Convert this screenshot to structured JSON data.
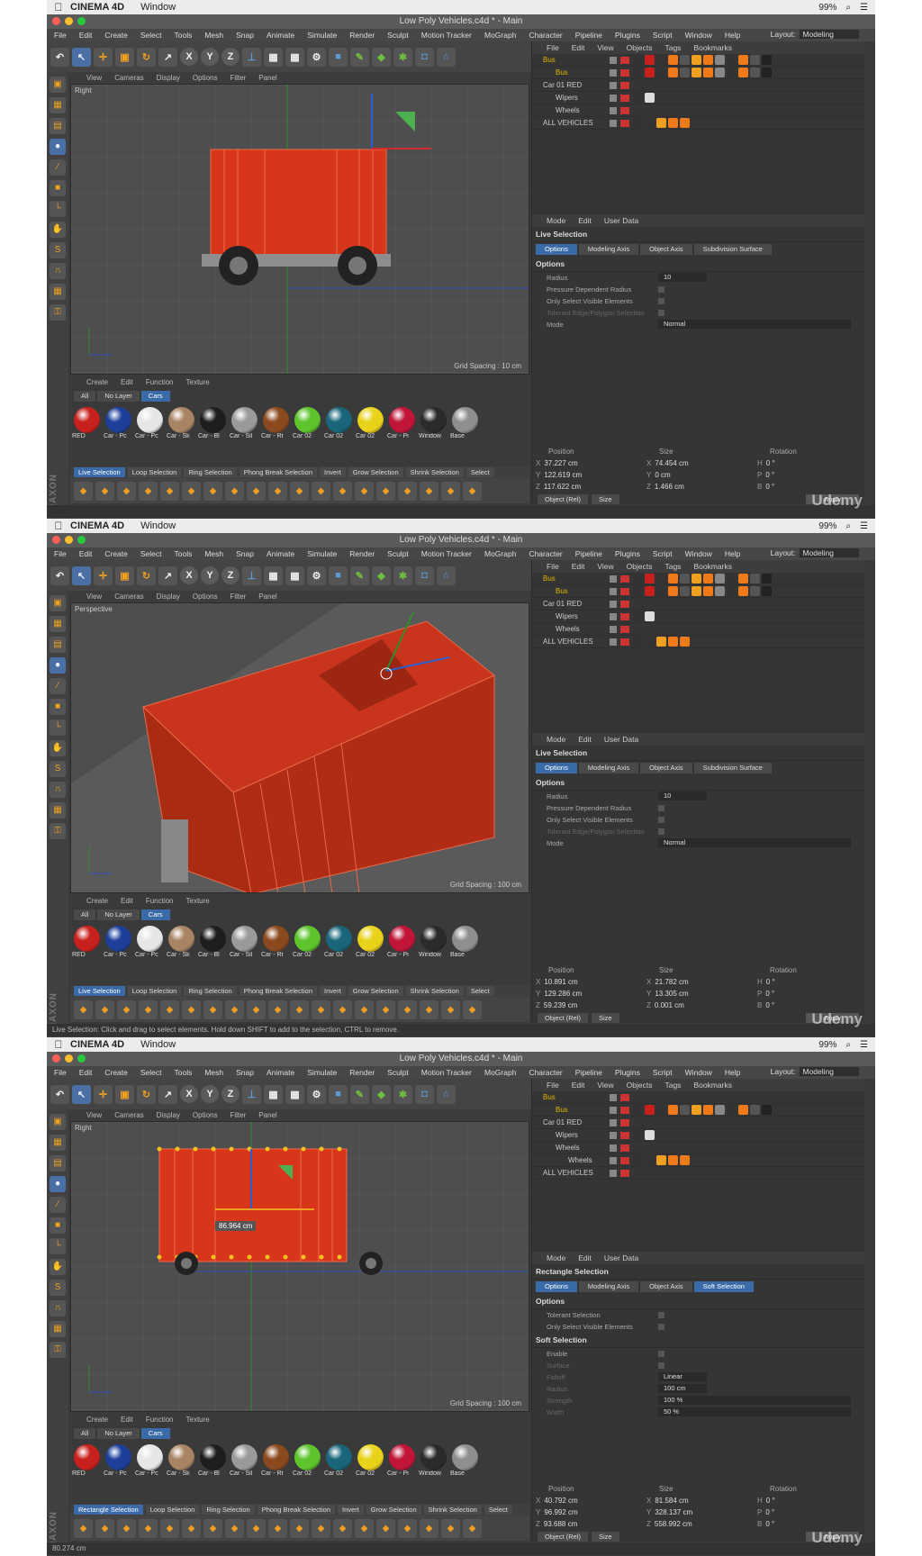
{
  "menubar": {
    "app": "CINEMA 4D",
    "window": "Window",
    "battery": "99%"
  },
  "title": "Low Poly Vehicles.c4d * - Main",
  "menus": [
    "File",
    "Edit",
    "Create",
    "Select",
    "Tools",
    "Mesh",
    "Snap",
    "Animate",
    "Simulate",
    "Render",
    "Sculpt",
    "Motion Tracker",
    "MoGraph",
    "Character",
    "Pipeline",
    "Plugins",
    "Script",
    "Window",
    "Help"
  ],
  "layout_label": "Layout:",
  "layout_value": "Modeling",
  "vp_menu": [
    "View",
    "Cameras",
    "Display",
    "Options",
    "Filter",
    "Panel"
  ],
  "obj_menu": [
    "File",
    "Edit",
    "View",
    "Objects",
    "Tags",
    "Bookmarks"
  ],
  "attr_menu": [
    "Mode",
    "Edit",
    "User Data"
  ],
  "mat_menu": [
    "Create",
    "Edit",
    "Function",
    "Texture"
  ],
  "mat_tabs": [
    "All",
    "No Layer",
    "Cars"
  ],
  "materials": [
    {
      "label": "RED",
      "color": "#c8201c"
    },
    {
      "label": "Car - Pc",
      "color": "#1d3f9a"
    },
    {
      "label": "Car - Pc",
      "color": "#e6e6e6"
    },
    {
      "label": "Car - Sk",
      "color": "#a88462"
    },
    {
      "label": "Car - Bl",
      "color": "#1e1e1e"
    },
    {
      "label": "Car - Sil",
      "color": "#9a9a9a"
    },
    {
      "label": "Car - Rt",
      "color": "#8a4a1e"
    },
    {
      "label": "Car 02",
      "color": "#5dc42b"
    },
    {
      "label": "Car 02",
      "color": "#19657a"
    },
    {
      "label": "Car 02",
      "color": "#e8d21a"
    },
    {
      "label": "Car - Pi",
      "color": "#c01538"
    },
    {
      "label": "Window",
      "color": "#2b2b2b"
    },
    {
      "label": "Base",
      "color": "#8e8e8e"
    }
  ],
  "sel_tools": [
    "Live Selection",
    "Loop Selection",
    "Ring Selection",
    "Phong Break Selection",
    "Invert",
    "Grow Selection",
    "Shrink Selection",
    "Select"
  ],
  "coords_head": [
    "Position",
    "Size",
    "Rotation"
  ],
  "coords_foot": {
    "mode": "Object (Rel)",
    "size": "Size",
    "apply": "Apply"
  },
  "watermark": "Udemy",
  "frames": [
    {
      "viewport_label": "Right",
      "grid": "Grid Spacing : 10 cm",
      "objects": [
        {
          "name": "Bus",
          "color": "#e5b400",
          "indent": 0
        },
        {
          "name": "Bus",
          "color": "#e5b400",
          "indent": 1
        },
        {
          "name": "Car 01 RED",
          "color": "#cccccc",
          "indent": 0
        },
        {
          "name": "Wipers",
          "color": "#cccccc",
          "indent": 1
        },
        {
          "name": "Wheels",
          "color": "#cccccc",
          "indent": 1
        },
        {
          "name": "ALL VEHICLES",
          "color": "#cccccc",
          "indent": 0
        }
      ],
      "tool_title": "Live Selection",
      "attr_tabs": [
        "Options",
        "Modeling Axis",
        "Object Axis",
        "Subdivision Surface"
      ],
      "section": "Options",
      "attrs": [
        {
          "label": "Radius",
          "value": "10",
          "kind": "num"
        },
        {
          "label": "Pressure Dependent Radius",
          "kind": "chk"
        },
        {
          "label": "Only Select Visible Elements",
          "kind": "chk"
        },
        {
          "label": "Tolerant Edge/Polygon Selection",
          "kind": "chk",
          "dim": true
        },
        {
          "label": "Mode",
          "value": "Normal",
          "kind": "wide"
        }
      ],
      "coords": [
        [
          "X",
          "37.227 cm",
          "X",
          "74.454 cm",
          "H",
          "0 °"
        ],
        [
          "Y",
          "122.619 cm",
          "Y",
          "0 cm",
          "P",
          "0 °"
        ],
        [
          "Z",
          "117.622 cm",
          "Z",
          "1.466 cm",
          "B",
          "0 °"
        ]
      ],
      "status": ""
    },
    {
      "viewport_label": "Perspective",
      "grid": "Grid Spacing : 100 cm",
      "objects": [
        {
          "name": "Bus",
          "color": "#e5b400",
          "indent": 0
        },
        {
          "name": "Bus",
          "color": "#e5b400",
          "indent": 1
        },
        {
          "name": "Car 01 RED",
          "color": "#cccccc",
          "indent": 0
        },
        {
          "name": "Wipers",
          "color": "#cccccc",
          "indent": 1
        },
        {
          "name": "Wheels",
          "color": "#cccccc",
          "indent": 1
        },
        {
          "name": "ALL VEHICLES",
          "color": "#cccccc",
          "indent": 0
        }
      ],
      "tool_title": "Live Selection",
      "attr_tabs": [
        "Options",
        "Modeling Axis",
        "Object Axis",
        "Subdivision Surface"
      ],
      "section": "Options",
      "attrs": [
        {
          "label": "Radius",
          "value": "10",
          "kind": "num"
        },
        {
          "label": "Pressure Dependent Radius",
          "kind": "chk"
        },
        {
          "label": "Only Select Visible Elements",
          "kind": "chk"
        },
        {
          "label": "Tolerant Edge/Polygon Selection",
          "kind": "chk",
          "dim": true
        },
        {
          "label": "Mode",
          "value": "Normal",
          "kind": "wide"
        }
      ],
      "coords": [
        [
          "X",
          "10.891 cm",
          "X",
          "21.782 cm",
          "H",
          "0 °"
        ],
        [
          "Y",
          "129.286 cm",
          "Y",
          "13.305 cm",
          "P",
          "0 °"
        ],
        [
          "Z",
          "59.239 cm",
          "Z",
          "0.001 cm",
          "B",
          "0 °"
        ]
      ],
      "status": "Live Selection: Click and drag to select elements. Hold down SHIFT to add to the selection, CTRL to remove."
    },
    {
      "viewport_label": "Right",
      "grid": "Grid Spacing : 100 cm",
      "dimension": "86.964 cm",
      "objects": [
        {
          "name": "Bus",
          "color": "#e5b400",
          "indent": 0
        },
        {
          "name": "Bus",
          "color": "#e5b400",
          "indent": 1
        },
        {
          "name": "Car 01 RED",
          "color": "#cccccc",
          "indent": 0
        },
        {
          "name": "Wipers",
          "color": "#cccccc",
          "indent": 1
        },
        {
          "name": "Wheels",
          "color": "#cccccc",
          "indent": 1
        },
        {
          "name": "Wheels",
          "color": "#cccccc",
          "indent": 2
        },
        {
          "name": "ALL VEHICLES",
          "color": "#cccccc",
          "indent": 0
        }
      ],
      "tool_title": "Rectangle Selection",
      "attr_tabs": [
        "Options",
        "Modeling Axis",
        "Object Axis",
        "Soft Selection"
      ],
      "section": "Options",
      "attrs": [
        {
          "label": "Tolerant Selection",
          "kind": "chk"
        },
        {
          "label": "Only Select Visible Elements",
          "kind": "chk"
        }
      ],
      "section2": "Soft Selection",
      "attrs2": [
        {
          "label": "Enable",
          "kind": "chk"
        },
        {
          "label": "Surface",
          "kind": "chk",
          "dim": true
        },
        {
          "label": "Falloff",
          "value": "Linear",
          "kind": "num",
          "dim": true
        },
        {
          "label": "Radius",
          "value": "100 cm",
          "kind": "num",
          "dim": true
        },
        {
          "label": "Strength",
          "value": "100 %",
          "kind": "wide",
          "dim": true
        },
        {
          "label": "Width",
          "value": "50 %",
          "kind": "wide",
          "dim": true
        }
      ],
      "coords": [
        [
          "X",
          "40.792 cm",
          "X",
          "81.584 cm",
          "H",
          "0 °"
        ],
        [
          "Y",
          "96.992 cm",
          "Y",
          "328.137 cm",
          "P",
          "0 °"
        ],
        [
          "Z",
          "93.688 cm",
          "Z",
          "558.992 cm",
          "B",
          "0 °"
        ]
      ],
      "sel_first": "Rectangle Selection",
      "status": "80.274 cm"
    }
  ]
}
